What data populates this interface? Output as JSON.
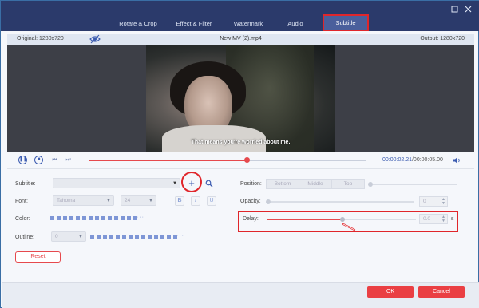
{
  "tabs": [
    {
      "label": "Rotate & Crop",
      "active": false
    },
    {
      "label": "Effect & Filter",
      "active": false
    },
    {
      "label": "Watermark",
      "active": false
    },
    {
      "label": "Audio",
      "active": false
    },
    {
      "label": "Subtitle",
      "active": true
    }
  ],
  "window": {
    "restore_icon": "restore-icon",
    "close_icon": "close-icon"
  },
  "infobar": {
    "original": "Original: 1280x720",
    "file_name": "New MV (2).mp4",
    "output": "Output: 1280x720"
  },
  "video": {
    "subtitle_text": "That means you're worried about me."
  },
  "playback": {
    "current_time": "00:00:02.21",
    "total_time": "/00:00:05.00",
    "progress_fraction": 0.57
  },
  "subtitle_settings": {
    "subtitle_label": "Subtitle:",
    "subtitle_value": "",
    "font_label": "Font:",
    "font_value": "Tahoma",
    "font_size": "24",
    "bold": "B",
    "italic": "I",
    "underline": "U",
    "color_label": "Color:",
    "outline_label": "Outline:",
    "outline_value": "0",
    "reset_label": "Reset",
    "dots": "···"
  },
  "position_settings": {
    "position_label": "Position:",
    "options": [
      "Bottom",
      "Middle",
      "Top"
    ],
    "opacity_label": "Opacity:",
    "opacity_value": "0",
    "delay_label": "Delay:",
    "delay_value": "0.0",
    "delay_unit": "s"
  },
  "footer": {
    "ok_label": "OK",
    "cancel_label": "Cancel"
  },
  "colors": {
    "accent": "#3b5bb0",
    "danger": "#e6494d",
    "header": "#2b3a6b",
    "highlight": "#e0262b"
  }
}
